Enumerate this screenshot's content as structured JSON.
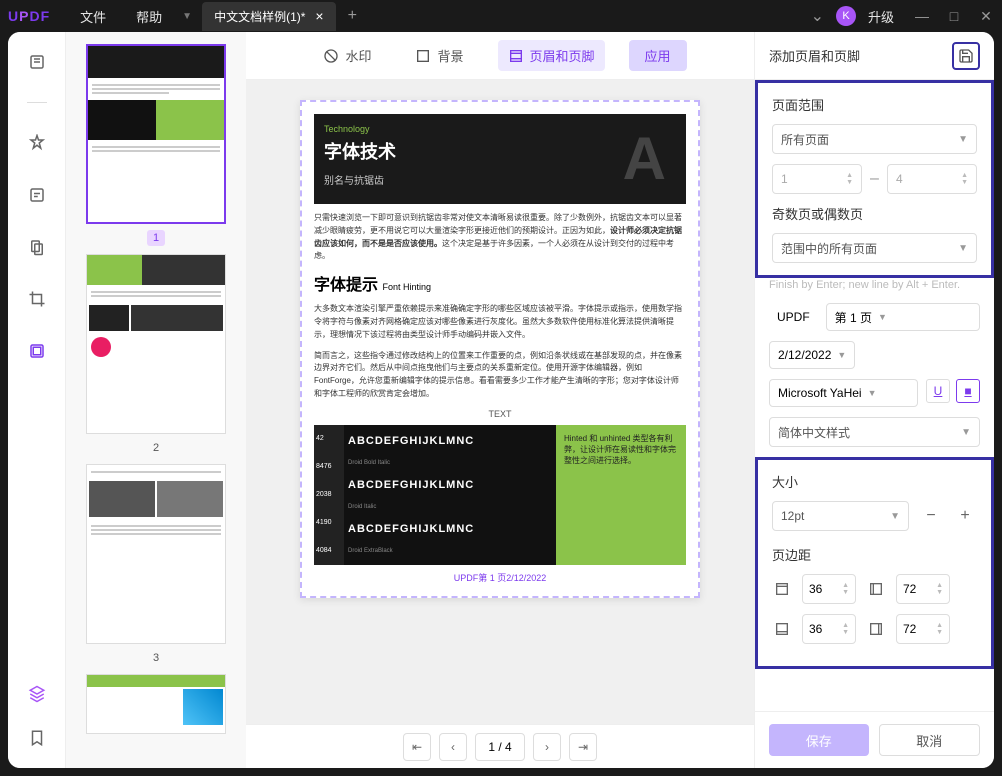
{
  "titlebar": {
    "logo": "UPDF",
    "menu": {
      "file": "文件",
      "help": "帮助"
    },
    "tab": {
      "name": "中文文档样例(1)*"
    },
    "avatar_letter": "K",
    "upgrade": "升级"
  },
  "top_toolbar": {
    "watermark": "水印",
    "background": "背景",
    "header_footer": "页眉和页脚",
    "apply": "应用"
  },
  "right_panel": {
    "title": "添加页眉和页脚",
    "page_range": {
      "label": "页面范围",
      "all_pages": "所有页面",
      "from": "1",
      "to": "4",
      "parity_label": "奇数页或偶数页",
      "parity_value": "范围中的所有页面"
    },
    "finish_hint": "Finish by Enter; new line by Alt + Enter.",
    "brand": "UPDF",
    "page_no": "第 1 页",
    "date": "2/12/2022",
    "font": "Microsoft YaHei",
    "style": "简体中文样式",
    "size": {
      "label": "大小",
      "value": "12pt"
    },
    "margins": {
      "label": "页边距",
      "top": "36",
      "bottom": "36",
      "left": "72",
      "right": "72"
    },
    "save": "保存",
    "cancel": "取消"
  },
  "document": {
    "tech_label": "Technology",
    "tech_title": "字体技术",
    "tech_sub": "别名与抗锯齿",
    "para1": "只需快速浏览一下即可意识到抗锯齿非常对使文本清晰易读很重要。除了少数例外，抗锯齿文本可以显著减少眼睛疲劳，更不用说它可以大量渲染字形更接近他们的预期设计。正因为如此，",
    "para1_bold": "设计师必须决定抗锯齿应该如何，而不是是否应该使用。",
    "para1_end": "这个决定是基于许多因素，一个人必须在从设计到交付的过程中考虑。",
    "hint_title": "字体提示",
    "hint_sub": "Font Hinting",
    "para2": "大多数文本渲染引擎严重依赖提示来准确确定字形的哪些区域应该被平滑。字体提示或指示，使用数学指令将字符与像素对齐网格确定应该对哪些像素进行灰度化。虽然大多数软件使用标准化算法提供清晰提示，理想情况下该过程将由类型设计师手动编码并嵌入文件。",
    "para3": "简而言之，这些指令通过修改结构上的位置来工作重要的点，例如沿条状线或在基部发现的点，并在像素边界对齐它们。然后从中间点拖曳他们与主要点的关系重新定位。使用开源字体编辑器，例如 FontForge，允许您重新编辑字体的提示信息。看看需要多少工作才能产生清晰的字形；您对字体设计师和字体工程师的欣赏肯定会增加。",
    "text_label": "TEXT",
    "sample_text": "ABCDEFGHIJKLMNC",
    "sample_labels": [
      "Droid Bold Italic",
      "Droid Italic",
      "Droid ExtraBlack"
    ],
    "sample_nums": [
      "42",
      "8476",
      "2038",
      "4190",
      "4084"
    ],
    "green_text": "Hinted 和 unhinted 类型各有利弊，让设计师在易读性和字体完整性之间进行选择。",
    "footer_text": "UPDF第 1 页2/12/2022"
  },
  "page_nav": {
    "display": "1 / 4"
  },
  "thumbnails": {
    "pages": [
      "1",
      "2",
      "3"
    ]
  }
}
